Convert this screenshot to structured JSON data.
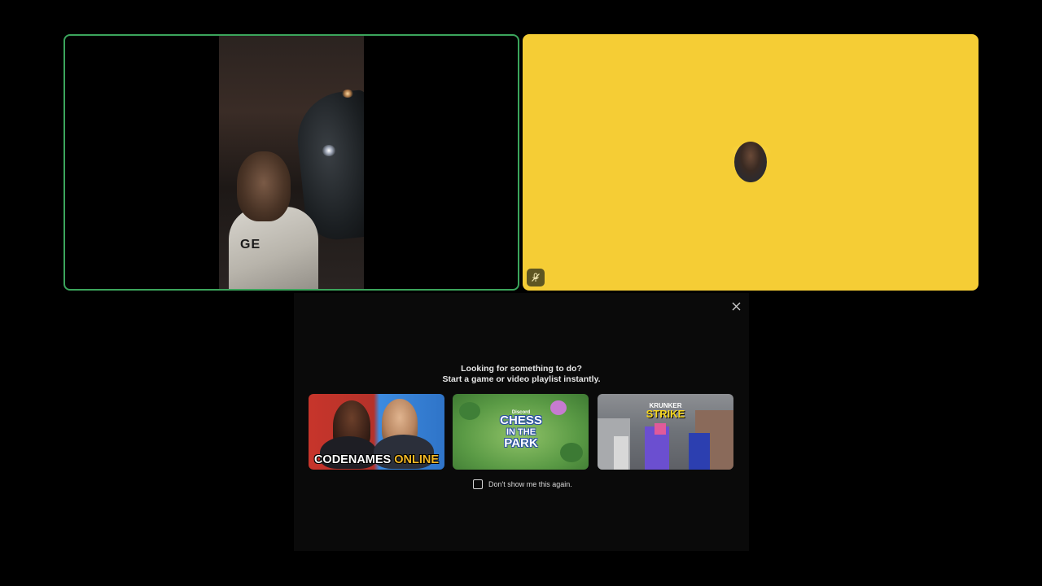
{
  "tiles": {
    "video": {
      "shirt_text": "GE"
    },
    "avatar": {
      "background": "#f5cd35",
      "mute_icon": "mic-muted-icon"
    }
  },
  "panel": {
    "close_icon": "close-icon",
    "heading_line1": "Looking for something to do?",
    "heading_line2": "Start a game or video playlist instantly.",
    "activities": [
      {
        "title_main": "CODENAMES",
        "title_accent": "ONLINE"
      },
      {
        "brand": "Discord",
        "line1": "CHESS",
        "line2": "IN THE",
        "line3": "PARK"
      },
      {
        "line1": "KRUNKER",
        "line2": "STRIKE"
      }
    ],
    "checkbox": {
      "label": "Don't show me this again.",
      "checked": false
    }
  },
  "colors": {
    "speaking_border": "#3ba55c",
    "panel_bg": "#0a0a0a"
  }
}
